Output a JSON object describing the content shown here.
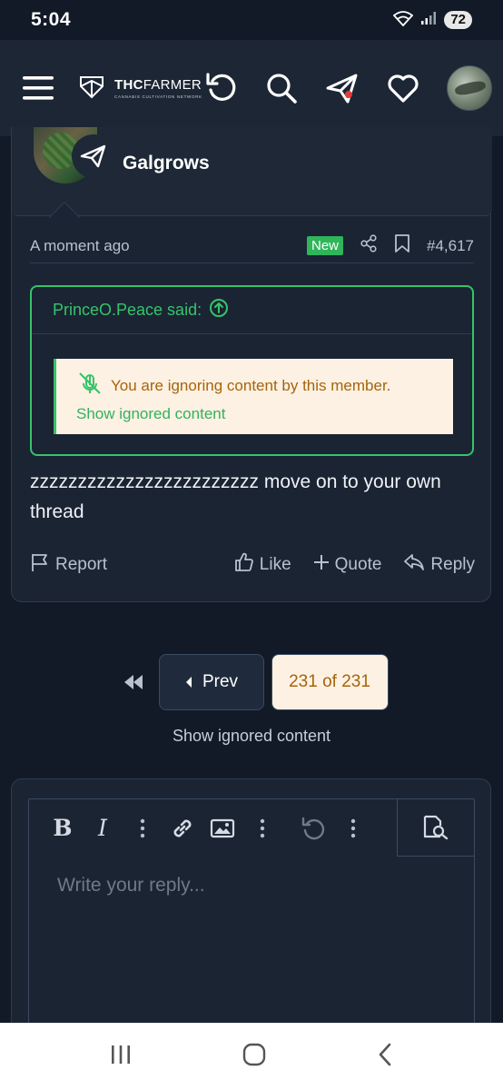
{
  "status_bar": {
    "time": "5:04",
    "battery": "72"
  },
  "navbar": {
    "logo_main_bold": "THC",
    "logo_main_rest": "FARMER",
    "logo_sub": "CANNABIS CULTIVATION NETWORK",
    "icons": [
      "menu-icon",
      "refresh-icon",
      "search-icon",
      "send-icon",
      "heart-icon"
    ]
  },
  "post": {
    "author": "Galgrows",
    "time": "A moment ago",
    "new_badge": "New",
    "post_number": "#4,617",
    "quote": {
      "author_said": "PrinceO.Peace said:",
      "ignored_message": "You are ignoring content by this member.",
      "show_ignored_link": "Show ignored content"
    },
    "body": "zzzzzzzzzzzzzzzzzzzzzzzz move on to your own thread",
    "actions": {
      "report": "Report",
      "like": "Like",
      "quote": "Quote",
      "reply": "Reply"
    }
  },
  "pagination": {
    "prev": "Prev",
    "current": "231 of 231"
  },
  "show_ignored": "Show ignored content",
  "editor": {
    "placeholder": "Write your reply...",
    "bold": "B",
    "italic": "I"
  },
  "colors": {
    "accent_green": "#35c46a",
    "warn_text": "#a6640c",
    "warn_bg": "#fcf1e2",
    "background": "#111a26"
  }
}
